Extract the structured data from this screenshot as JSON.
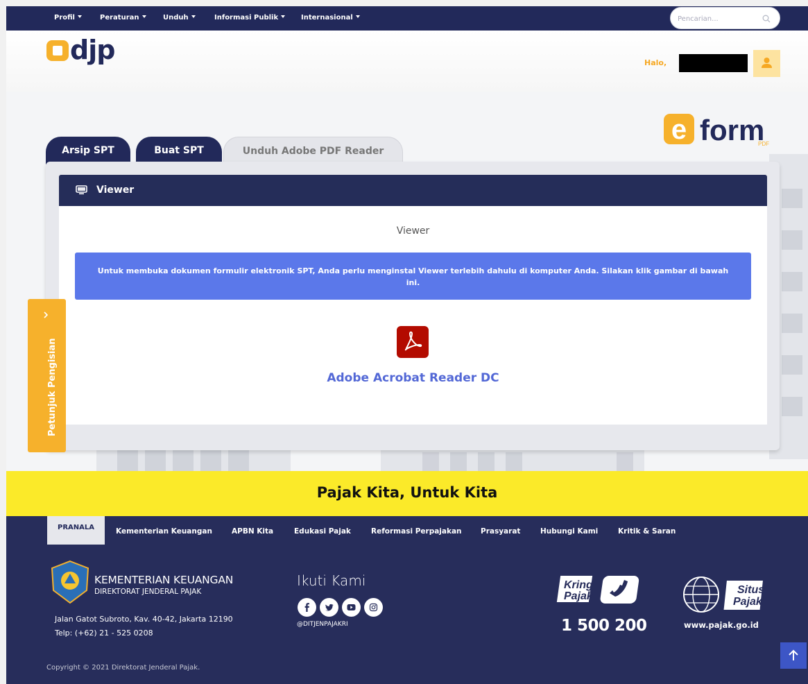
{
  "topnav": {
    "menu": [
      {
        "label": "Profil"
      },
      {
        "label": "Peraturan"
      },
      {
        "label": "Unduh"
      },
      {
        "label": "Informasi Publik"
      },
      {
        "label": "Internasional"
      }
    ],
    "search_placeholder": "Pencarian..."
  },
  "header": {
    "logo_text": "djp",
    "greeting": "Halo,"
  },
  "eform_logo": "eform",
  "tabs": [
    {
      "label": "Arsip SPT"
    },
    {
      "label": "Buat SPT"
    },
    {
      "label": "Unduh Adobe PDF Reader"
    }
  ],
  "panel": {
    "title": "Viewer",
    "subtitle": "Viewer",
    "notice": "Untuk membuka dokumen formulir elektronik SPT, Anda perlu menginstal Viewer terlebih dahulu di komputer Anda. Silakan klik gambar di bawah ini.",
    "download_link": "Adobe Acrobat Reader DC"
  },
  "side_tab": {
    "label": "Petunjuk Pengisian"
  },
  "tagline": "Pajak Kita, Untuk Kita",
  "footer": {
    "pranala": "PRANALA",
    "links": [
      {
        "label": "Kementerian Keuangan"
      },
      {
        "label": "APBN Kita"
      },
      {
        "label": "Edukasi Pajak"
      },
      {
        "label": "Reformasi Perpajakan"
      },
      {
        "label": "Prasyarat"
      },
      {
        "label": "Hubungi Kami"
      },
      {
        "label": "Kritik & Saran"
      }
    ],
    "org_name": "KEMENTERIAN KEUANGAN",
    "org_sub": "DIREKTORAT JENDERAL PAJAK",
    "address": "Jalan Gatot Subroto, Kav. 40-42, Jakarta 12190",
    "phone": "Telp: (+62) 21 - 525 0208",
    "follow_title": "Ikuti Kami",
    "social_handle": "@DITJENPAJAKRI",
    "kring_label_1": "Kring",
    "kring_label_2": "Pajak",
    "kring_number": "1 500 200",
    "situs_label_1": "Situs",
    "situs_label_2": "Pajak",
    "situs_url": "www.pajak.go.id",
    "copyright": "Copyright ©  2021 Direktorat Jenderal Pajak."
  },
  "colors": {
    "navy": "#22295a",
    "orange": "#f6b12c",
    "yellow": "#fbea29",
    "alert_blue": "#5b78ea",
    "pdf_red": "#b30b00"
  }
}
